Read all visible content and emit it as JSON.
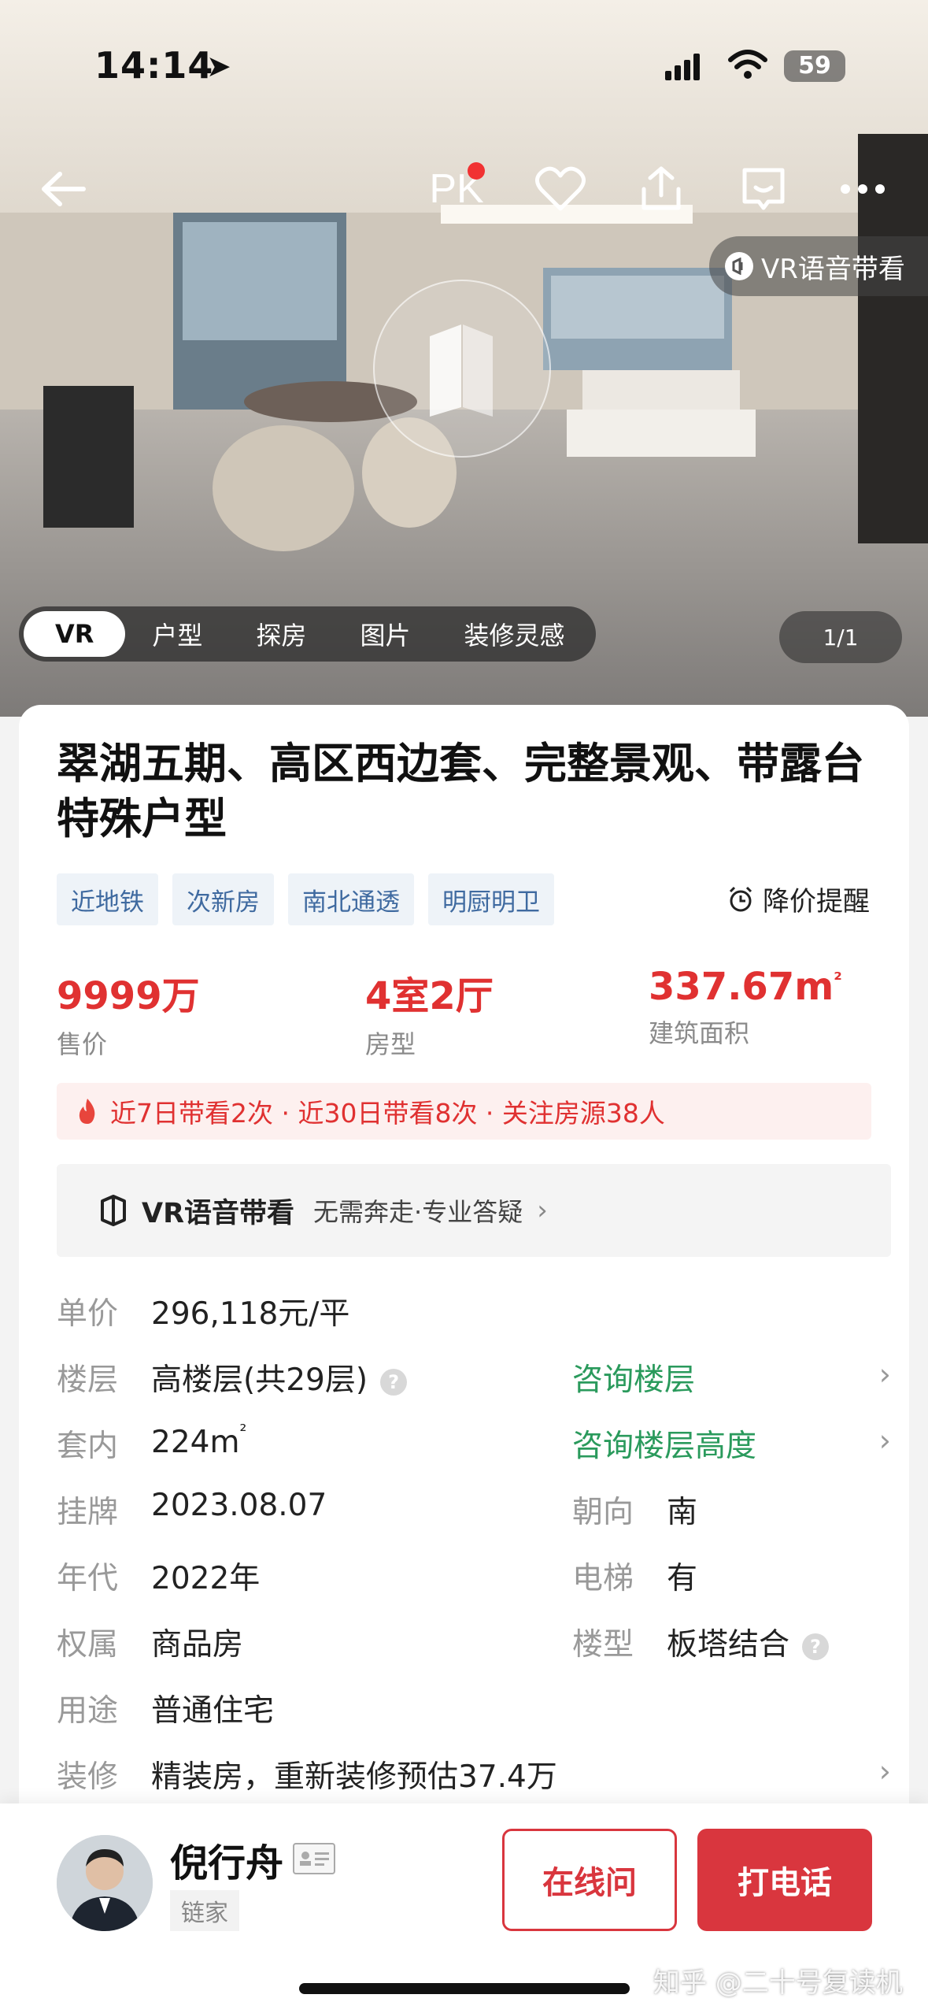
{
  "status_bar": {
    "time": "14:14",
    "battery": "59"
  },
  "header": {
    "pk_label": "PK",
    "vr_voice_label": "VR语音带看"
  },
  "media": {
    "tabs": [
      {
        "label": "VR",
        "active": true
      },
      {
        "label": "户型",
        "active": false
      },
      {
        "label": "探房",
        "active": false
      },
      {
        "label": "图片",
        "active": false
      },
      {
        "label": "装修灵感",
        "active": false
      }
    ],
    "pager": "1/1"
  },
  "listing": {
    "title": "翠湖五期、高区西边套、完整景观、带露台特殊户型",
    "tags": [
      "近地铁",
      "次新房",
      "南北通透",
      "明厨明卫"
    ],
    "price_alert": "降价提醒",
    "stats": [
      {
        "value": "9999万",
        "label": "售价"
      },
      {
        "value": "4室2厅",
        "label": "房型"
      },
      {
        "value": "337.67m",
        "sup": "²",
        "label": "建筑面积"
      }
    ],
    "hot_text": "近7日带看2次 · 近30日带看8次 · 关注房源38人",
    "vr_promo": {
      "title": "VR语音带看",
      "subtitle": "无需奔走·专业答疑"
    },
    "details": {
      "unit_price_label": "单价",
      "unit_price": "296,118元/平",
      "floor_label": "楼层",
      "floor": "高楼层(共29层)",
      "floor_link": "咨询楼层",
      "inner_label": "套内",
      "inner": "224m",
      "inner_sup": "²",
      "height_link": "咨询楼层高度",
      "listed_label": "挂牌",
      "listed": "2023.08.07",
      "orientation_label": "朝向",
      "orientation": "南",
      "year_label": "年代",
      "year": "2022年",
      "elevator_label": "电梯",
      "elevator": "有",
      "ownership_label": "权属",
      "ownership": "商品房",
      "building_type_label": "楼型",
      "building_type": "板塔结合",
      "usage_label": "用途",
      "usage": "普通住宅",
      "decor_label": "装修",
      "decor": "精装房，重新装修预估37.4万"
    }
  },
  "agent": {
    "name": "倪行舟",
    "company": "链家",
    "online_label": "在线问",
    "call_label": "打电话"
  },
  "watermark": "知乎 @二十号复读机",
  "colors": {
    "accent_red": "#e03131",
    "link_green": "#2a9a5c",
    "tag_blue": "#3f6aa0"
  }
}
